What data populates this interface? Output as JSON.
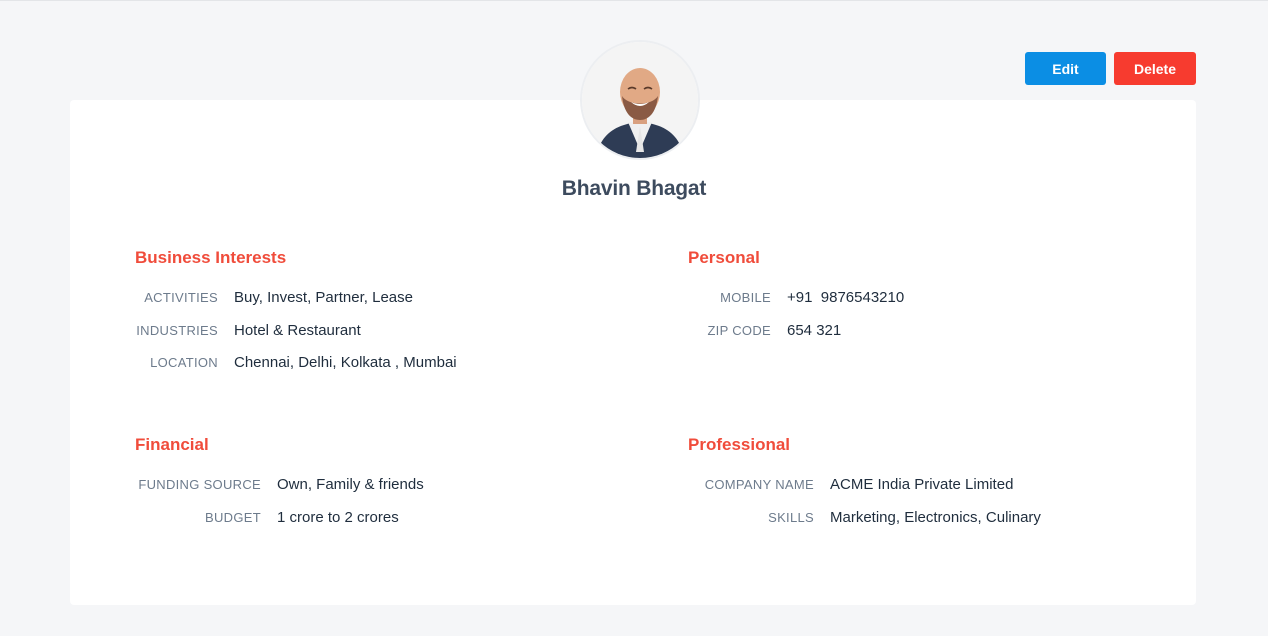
{
  "profile": {
    "name": "Bhavin Bhagat"
  },
  "actions": {
    "edit_label": "Edit",
    "delete_label": "Delete"
  },
  "sections": {
    "business": {
      "title": "Business Interests",
      "rows": [
        {
          "label": "ACTIVITIES",
          "value": "Buy, Invest, Partner, Lease"
        },
        {
          "label": "INDUSTRIES",
          "value": "Hotel & Restaurant"
        },
        {
          "label": "LOCATION",
          "value": "Chennai, Delhi, Kolkata , Mumbai"
        }
      ]
    },
    "personal": {
      "title": "Personal",
      "rows": [
        {
          "label": "MOBILE",
          "value": "+91  9876543210"
        },
        {
          "label": "ZIP CODE",
          "value": "654 321"
        }
      ]
    },
    "financial": {
      "title": "Financial",
      "rows": [
        {
          "label": "FUNDING SOURCE",
          "value": "Own, Family & friends"
        },
        {
          "label": "BUDGET",
          "value": "1 crore to 2 crores"
        }
      ]
    },
    "professional": {
      "title": "Professional",
      "rows": [
        {
          "label": "COMPANY NAME",
          "value": "ACME India Private Limited"
        },
        {
          "label": "SKILLS",
          "value": "Marketing, Electronics, Culinary"
        }
      ]
    }
  },
  "colors": {
    "accent_heading": "#f04c3b",
    "edit_button": "#0b8ee4",
    "delete_button": "#f73b2f",
    "background": "#f5f6f8"
  }
}
